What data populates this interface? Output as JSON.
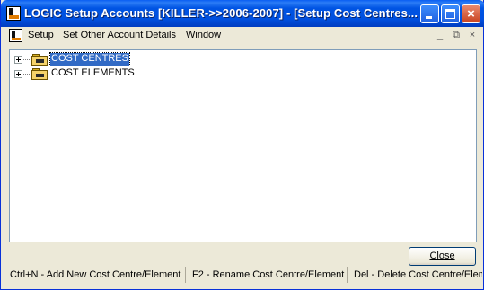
{
  "window": {
    "title": "LOGIC Setup Accounts  [KILLER->>2006-2007] - [Setup Cost Centres..."
  },
  "menubar": {
    "items": [
      "Setup",
      "Set Other Account Details",
      "Window"
    ],
    "mdi_controls": [
      "_",
      "⧉",
      "×"
    ]
  },
  "tree": {
    "nodes": [
      {
        "label": "COST CENTRES",
        "selected": true
      },
      {
        "label": "COST ELEMENTS",
        "selected": false
      }
    ]
  },
  "buttons": {
    "close_label": "Close"
  },
  "statusbar": {
    "hints": [
      "Ctrl+N -  Add New Cost Centre/Element",
      "F2 - Rename  Cost Centre/Element",
      "Del - Delete Cost Centre/Element"
    ]
  },
  "colors": {
    "titlebar": "#0054e3",
    "selection": "#316ac5",
    "window_bg": "#ece9d8"
  },
  "icons": {
    "app": "logic-app-icon",
    "tree_node": "folder-icon",
    "expander": "plus-expander-icon"
  }
}
